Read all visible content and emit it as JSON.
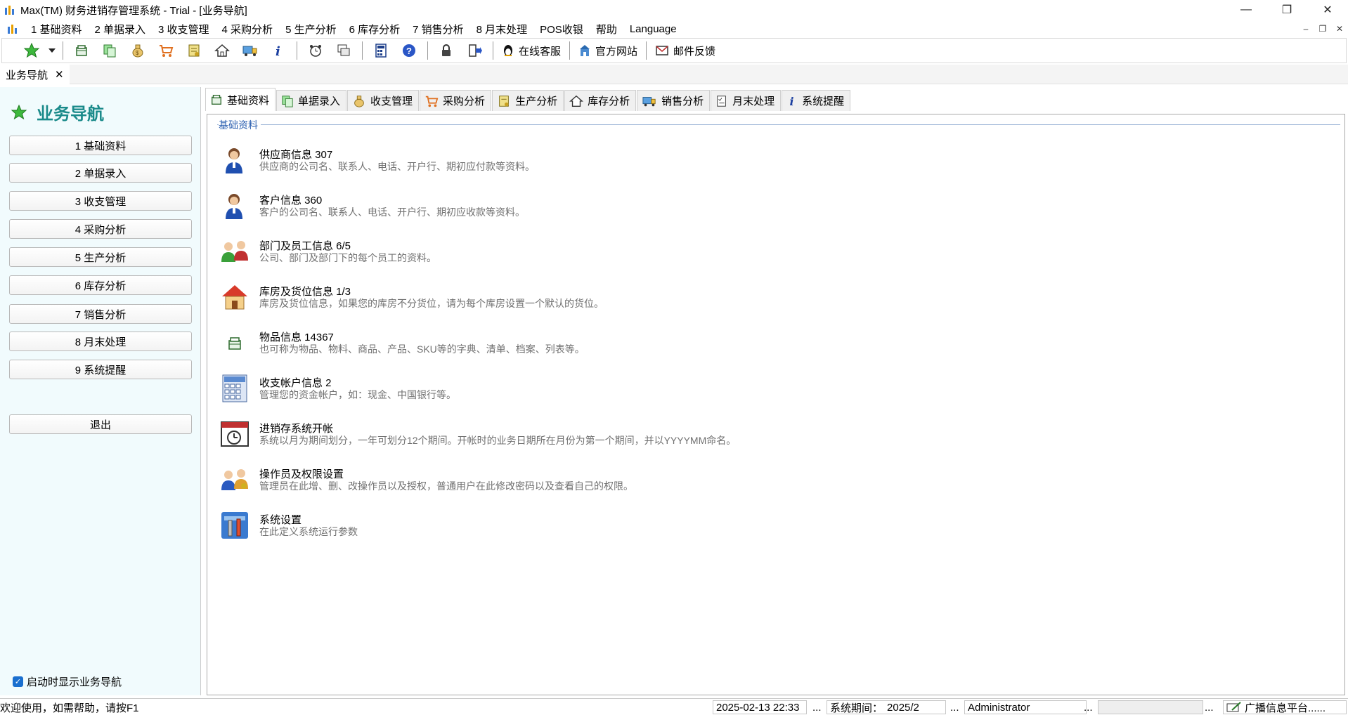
{
  "window": {
    "title": "Max(TM) 财务进销存管理系统 - Trial - [业务导航]",
    "minimize": "—",
    "restore": "❐",
    "close": "✕"
  },
  "menubar": {
    "items": [
      "1 基础资料",
      "2 单据录入",
      "3 收支管理",
      "4 采购分析",
      "5 生产分析",
      "6 库存分析",
      "7 销售分析",
      "8 月末处理",
      "POS收银",
      "帮助",
      "Language"
    ],
    "mdi_minimize": "–",
    "mdi_restore": "❐",
    "mdi_close": "✕"
  },
  "toolbar": {
    "online_service": "在线客服",
    "official_site": "官方网站",
    "email_feedback": "邮件反馈"
  },
  "doc_tab": {
    "label": "业务导航",
    "close": "✕"
  },
  "nav": {
    "title": "业务导航",
    "buttons": [
      "1 基础资料",
      "2 单据录入",
      "3 收支管理",
      "4 采购分析",
      "5 生产分析",
      "6 库存分析",
      "7 销售分析",
      "8 月末处理",
      "9 系统提醒"
    ],
    "exit": "退出",
    "startup_checkbox": "启动时显示业务导航",
    "startup_checked": true
  },
  "content": {
    "tabs": [
      "基础资料",
      "单据录入",
      "收支管理",
      "采购分析",
      "生产分析",
      "库存分析",
      "销售分析",
      "月末处理",
      "系统提醒"
    ],
    "active_tab": "基础资料",
    "group_label": "基础资料",
    "items": [
      {
        "title": "供应商信息 307",
        "desc": "供应商的公司名、联系人、电话、开户行、期初应付款等资料。",
        "icon": "person-icon"
      },
      {
        "title": "客户信息 360",
        "desc": "客户的公司名、联系人、电话、开户行、期初应收款等资料。",
        "icon": "person-icon"
      },
      {
        "title": "部门及员工信息 6/5",
        "desc": "公司、部门及部门下的每个员工的资料。",
        "icon": "group-icon"
      },
      {
        "title": "库房及货位信息 1/3",
        "desc": "库房及货位信息，如果您的库房不分货位，请为每个库房设置一个默认的货位。",
        "icon": "house-icon"
      },
      {
        "title": "物品信息 14367",
        "desc": "也可称为物品、物料、商品、产品、SKU等的字典、清单、档案、列表等。",
        "icon": "box-icon"
      },
      {
        "title": "收支帐户信息 2",
        "desc": "管理您的资金帐户，如：现金、中国银行等。",
        "icon": "calculator-icon"
      },
      {
        "title": "进销存系统开帐",
        "desc": "系统以月为期间划分，一年可划分12个期间。开帐时的业务日期所在月份为第一个期间，并以YYYYMM命名。",
        "icon": "calendar-clock-icon"
      },
      {
        "title": "操作员及权限设置",
        "desc": "管理员在此增、删、改操作员以及授权，普通用户在此修改密码以及查看自己的权限。",
        "icon": "users-key-icon"
      },
      {
        "title": "系统设置",
        "desc": "在此定义系统运行参数",
        "icon": "tools-icon"
      }
    ]
  },
  "statusbar": {
    "help": "欢迎使用，如需帮助，请按F1",
    "datetime": "2025-02-13 22:33",
    "period_label": "系统期间：",
    "period_value": "2025/2",
    "user": "Administrator",
    "ellipsis": "...",
    "broadcast": "广播信息平台......"
  }
}
